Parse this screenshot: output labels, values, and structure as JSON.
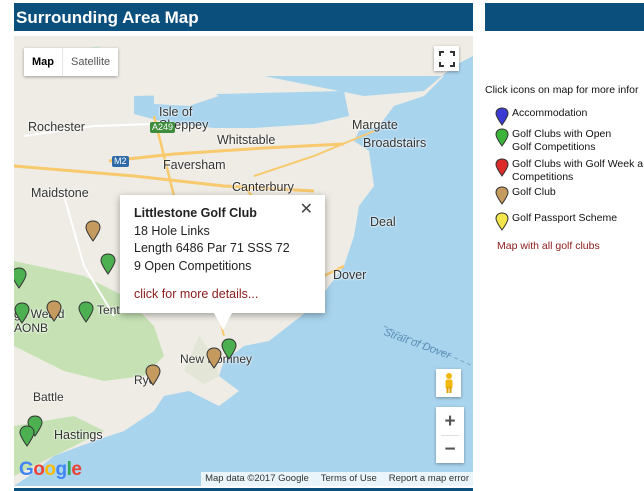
{
  "header": {
    "title": "Surrounding Area Map"
  },
  "map": {
    "type_buttons": [
      {
        "label": "Map",
        "active": true
      },
      {
        "label": "Satellite",
        "active": false
      }
    ],
    "place_labels": {
      "isle_of_sheppey": "Isle of\nSheppey",
      "rochester": "Rochester",
      "whitstable": "Whitstable",
      "margate": "Margate",
      "broadstairs": "Broadstairs",
      "faversham": "Faversham",
      "maidstone": "Maidstone",
      "canterbury": "Canterbury",
      "deal": "Deal",
      "dover": "Dover",
      "weald": "gh Weald",
      "aonb": "AONB",
      "tenterden": "Tent",
      "new_romney": "New Romney",
      "rye": "Rye",
      "battle": "Battle",
      "hastings": "Hastings",
      "strait": "Strait of Dover"
    },
    "road_labels": {
      "a249": "A249",
      "m2": "M2"
    },
    "popup": {
      "title": "Littlestone Golf Club",
      "line1": "18 Hole Links",
      "line2": "Length 6486 Par 71 SSS 72",
      "line3": "9 Open Competitions",
      "link": "click for more details...",
      "close": "✕"
    },
    "controls": {
      "zoom_in": "+",
      "zoom_out": "−"
    },
    "attribution": {
      "data": "Map data ©2017 Google",
      "terms": "Terms of Use",
      "report": "Report a map error"
    },
    "logo": "Google",
    "marker_colors": {
      "green": "#4caf50",
      "tan": "#c49a5e",
      "dark": "#2b2b2b"
    }
  },
  "sidebar": {
    "instructions": "Click icons on map for more infor",
    "legend": [
      {
        "label": "Accommodation",
        "color": "#3b3bd4"
      },
      {
        "label": "Golf Clubs with Open\nGolf Competitions",
        "color": "#3cb43c"
      },
      {
        "label": "Golf Clubs with Golf Week a\nCompetitions",
        "color": "#dc2b2b"
      },
      {
        "label": "Golf Club",
        "color": "#c49a5e"
      },
      {
        "label": "Golf Passport Scheme",
        "color": "#f2e64c"
      }
    ],
    "all_clubs_link": "Map with all golf clubs"
  }
}
